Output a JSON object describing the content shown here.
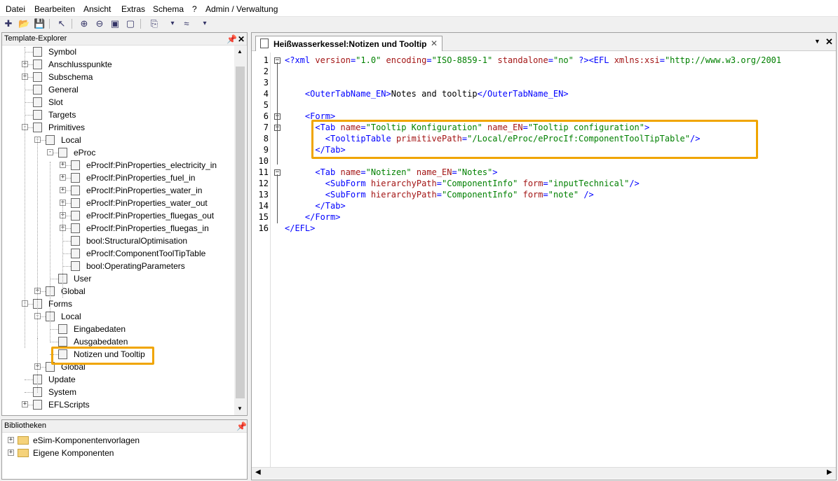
{
  "menu": [
    "Datei",
    "Bearbeiten",
    "Ansicht",
    "Extras",
    "Schema",
    "?",
    "Admin / Verwaltung"
  ],
  "toolbar_icons": [
    "new-icon",
    "open-icon",
    "save-icon",
    "pointer-icon",
    "zoom-in-icon",
    "zoom-out-icon",
    "zoom-fit-icon",
    "zoom-select-icon",
    "layout-icon",
    "dropdown-icon",
    "wave-icon",
    "dropdown-icon"
  ],
  "template_explorer": {
    "title": "Template-Explorer",
    "tree": [
      {
        "label": "Symbol",
        "exp": "",
        "lvl": 1
      },
      {
        "label": "Anschlusspunkte",
        "exp": "+",
        "lvl": 1
      },
      {
        "label": "Subschema",
        "exp": "+",
        "lvl": 1
      },
      {
        "label": "General",
        "exp": "",
        "lvl": 1
      },
      {
        "label": "Slot",
        "exp": "",
        "lvl": 1
      },
      {
        "label": "Targets",
        "exp": "",
        "lvl": 1
      },
      {
        "label": "Primitives",
        "exp": "-",
        "lvl": 1
      },
      {
        "label": "Local",
        "exp": "-",
        "lvl": 2
      },
      {
        "label": "eProc",
        "exp": "-",
        "lvl": 3
      },
      {
        "label": "eProcIf:PinProperties_electricity_in",
        "exp": "+",
        "lvl": 4
      },
      {
        "label": "eProcIf:PinProperties_fuel_in",
        "exp": "+",
        "lvl": 4
      },
      {
        "label": "eProcIf:PinProperties_water_in",
        "exp": "+",
        "lvl": 4
      },
      {
        "label": "eProcIf:PinProperties_water_out",
        "exp": "+",
        "lvl": 4
      },
      {
        "label": "eProcIf:PinProperties_fluegas_out",
        "exp": "+",
        "lvl": 4
      },
      {
        "label": "eProcIf:PinProperties_fluegas_in",
        "exp": "+",
        "lvl": 4
      },
      {
        "label": "bool:StructuralOptimisation",
        "exp": "",
        "lvl": 4
      },
      {
        "label": "eProcIf:ComponentToolTipTable",
        "exp": "",
        "lvl": 4
      },
      {
        "label": "bool:OperatingParameters",
        "exp": "",
        "lvl": 4
      },
      {
        "label": "User",
        "exp": "",
        "lvl": 3
      },
      {
        "label": "Global",
        "exp": "+",
        "lvl": 2
      },
      {
        "label": "Forms",
        "exp": "-",
        "lvl": 1
      },
      {
        "label": "Local",
        "exp": "-",
        "lvl": 2
      },
      {
        "label": "Eingabedaten",
        "exp": "",
        "lvl": 3
      },
      {
        "label": "Ausgabedaten",
        "exp": "",
        "lvl": 3
      },
      {
        "label": "Notizen und Tooltip",
        "exp": "",
        "lvl": 3
      },
      {
        "label": "Global",
        "exp": "+",
        "lvl": 2
      },
      {
        "label": "Update",
        "exp": "",
        "lvl": 1
      },
      {
        "label": "System",
        "exp": "",
        "lvl": 1
      },
      {
        "label": "EFLScripts",
        "exp": "+",
        "lvl": 1
      }
    ]
  },
  "libraries": {
    "title": "Bibliotheken",
    "items": [
      {
        "label": "eSim-Komponentenvorlagen"
      },
      {
        "label": "Eigene Komponenten"
      }
    ]
  },
  "editor": {
    "tab_title": "Heißwasserkessel:Notizen und Tooltip",
    "lines": [
      {
        "n": "1",
        "fold": "-",
        "parts": [
          [
            "tg",
            "<?xml "
          ],
          [
            "at",
            "version"
          ],
          [
            "tg",
            "="
          ],
          [
            "vl",
            "\"1.0\""
          ],
          [
            "tg",
            " "
          ],
          [
            "at",
            "encoding"
          ],
          [
            "tg",
            "="
          ],
          [
            "vl",
            "\"ISO-8859-1\""
          ],
          [
            "tg",
            " "
          ],
          [
            "at",
            "standalone"
          ],
          [
            "tg",
            "="
          ],
          [
            "vl",
            "\"no\""
          ],
          [
            "tg",
            " ?><EFL "
          ],
          [
            "at",
            "xmlns:xsi"
          ],
          [
            "tg",
            "="
          ],
          [
            "vl",
            "\"http://www.w3.org/2001"
          ]
        ]
      },
      {
        "n": "2",
        "fold": "",
        "parts": []
      },
      {
        "n": "3",
        "fold": "",
        "parts": []
      },
      {
        "n": "4",
        "fold": "",
        "parts": [
          [
            "tx",
            "    "
          ],
          [
            "tg",
            "<OuterTabName_EN>"
          ],
          [
            "tx",
            "Notes and tooltip"
          ],
          [
            "tg",
            "</OuterTabName_EN>"
          ]
        ]
      },
      {
        "n": "5",
        "fold": "",
        "parts": []
      },
      {
        "n": "6",
        "fold": "-",
        "parts": [
          [
            "tx",
            "    "
          ],
          [
            "tg",
            "<Form>"
          ]
        ]
      },
      {
        "n": "7",
        "fold": "-",
        "parts": [
          [
            "tx",
            "      "
          ],
          [
            "tg",
            "<Tab "
          ],
          [
            "at",
            "name"
          ],
          [
            "tg",
            "="
          ],
          [
            "vl",
            "\"Tooltip Konfiguration\""
          ],
          [
            "tg",
            " "
          ],
          [
            "at",
            "name_EN"
          ],
          [
            "tg",
            "="
          ],
          [
            "vl",
            "\"Tooltip configuration\""
          ],
          [
            "tg",
            ">"
          ]
        ]
      },
      {
        "n": "8",
        "fold": "",
        "parts": [
          [
            "tx",
            "        "
          ],
          [
            "tg",
            "<TooltipTable "
          ],
          [
            "at",
            "primitivePath"
          ],
          [
            "tg",
            "="
          ],
          [
            "vl",
            "\"/Local/eProc/eProcIf:ComponentToolTipTable\""
          ],
          [
            "tg",
            "/>"
          ]
        ]
      },
      {
        "n": "9",
        "fold": "",
        "parts": [
          [
            "tx",
            "      "
          ],
          [
            "tg",
            "</Tab>"
          ]
        ]
      },
      {
        "n": "10",
        "fold": "",
        "parts": []
      },
      {
        "n": "11",
        "fold": "-",
        "parts": [
          [
            "tx",
            "      "
          ],
          [
            "tg",
            "<Tab "
          ],
          [
            "at",
            "name"
          ],
          [
            "tg",
            "="
          ],
          [
            "vl",
            "\"Notizen\""
          ],
          [
            "tg",
            " "
          ],
          [
            "at",
            "name_EN"
          ],
          [
            "tg",
            "="
          ],
          [
            "vl",
            "\"Notes\""
          ],
          [
            "tg",
            ">"
          ]
        ]
      },
      {
        "n": "12",
        "fold": "",
        "parts": [
          [
            "tx",
            "        "
          ],
          [
            "tg",
            "<SubForm "
          ],
          [
            "at",
            "hierarchyPath"
          ],
          [
            "tg",
            "="
          ],
          [
            "vl",
            "\"ComponentInfo\""
          ],
          [
            "tg",
            " "
          ],
          [
            "at",
            "form"
          ],
          [
            "tg",
            "="
          ],
          [
            "vl",
            "\"inputTechnical\""
          ],
          [
            "tg",
            "/>"
          ]
        ]
      },
      {
        "n": "13",
        "fold": "",
        "parts": [
          [
            "tx",
            "        "
          ],
          [
            "tg",
            "<SubForm "
          ],
          [
            "at",
            "hierarchyPath"
          ],
          [
            "tg",
            "="
          ],
          [
            "vl",
            "\"ComponentInfo\""
          ],
          [
            "tg",
            " "
          ],
          [
            "at",
            "form"
          ],
          [
            "tg",
            "="
          ],
          [
            "vl",
            "\"note\""
          ],
          [
            "tg",
            " />"
          ]
        ]
      },
      {
        "n": "14",
        "fold": "",
        "parts": [
          [
            "tx",
            "      "
          ],
          [
            "tg",
            "</Tab>"
          ]
        ]
      },
      {
        "n": "15",
        "fold": "",
        "parts": [
          [
            "tx",
            "    "
          ],
          [
            "tg",
            "</Form>"
          ]
        ]
      },
      {
        "n": "16",
        "fold": "",
        "parts": [
          [
            "tg",
            "</EFL>"
          ]
        ]
      }
    ]
  },
  "colors": {
    "highlight": "#f0a500",
    "tag": "#0000ff",
    "attribute": "#a31515",
    "value": "#008000"
  }
}
